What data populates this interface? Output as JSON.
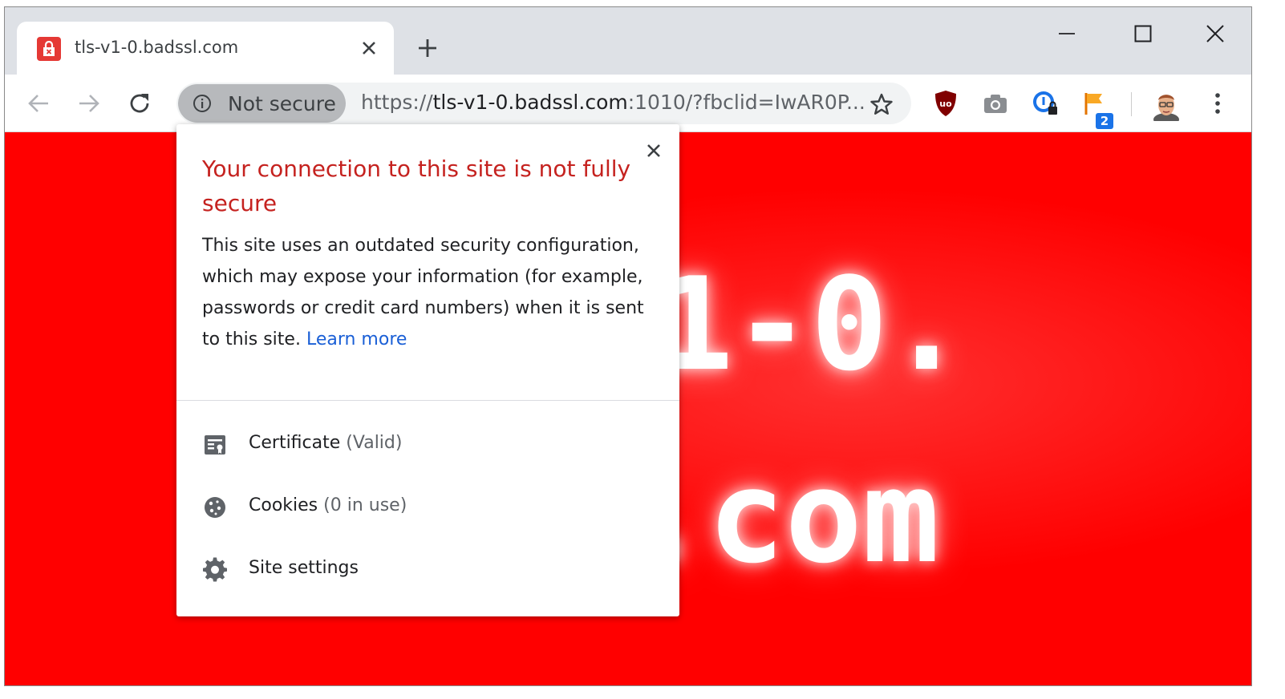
{
  "tab": {
    "title": "tls-v1-0.badssl.com"
  },
  "omnibox": {
    "security_chip": "Not secure",
    "url_scheme": "https://",
    "url_host": "tls-v1-0.badssl.com",
    "url_rest": ":1010/?fbclid=IwAR0P..."
  },
  "extensions": {
    "flag_badge": "2"
  },
  "page": {
    "line1": "1-0.",
    "line2": ".com"
  },
  "popup": {
    "title": "Your connection to this site is not fully secure",
    "body": "This site uses an outdated security configuration, which may expose your information (for example, passwords or credit card numbers) when it is sent to this site.",
    "learn_more": "Learn more",
    "items": [
      {
        "label": "Certificate",
        "sub": "(Valid)",
        "icon": "certificate-icon"
      },
      {
        "label": "Cookies",
        "sub": "(0 in use)",
        "icon": "cookie-icon"
      },
      {
        "label": "Site settings",
        "sub": "",
        "icon": "gear-icon"
      }
    ]
  },
  "colors": {
    "page_bg": "#ff0000",
    "warning_title": "#c5221f",
    "link": "#1a5fd6",
    "chip_bg": "#b7b9bc"
  }
}
